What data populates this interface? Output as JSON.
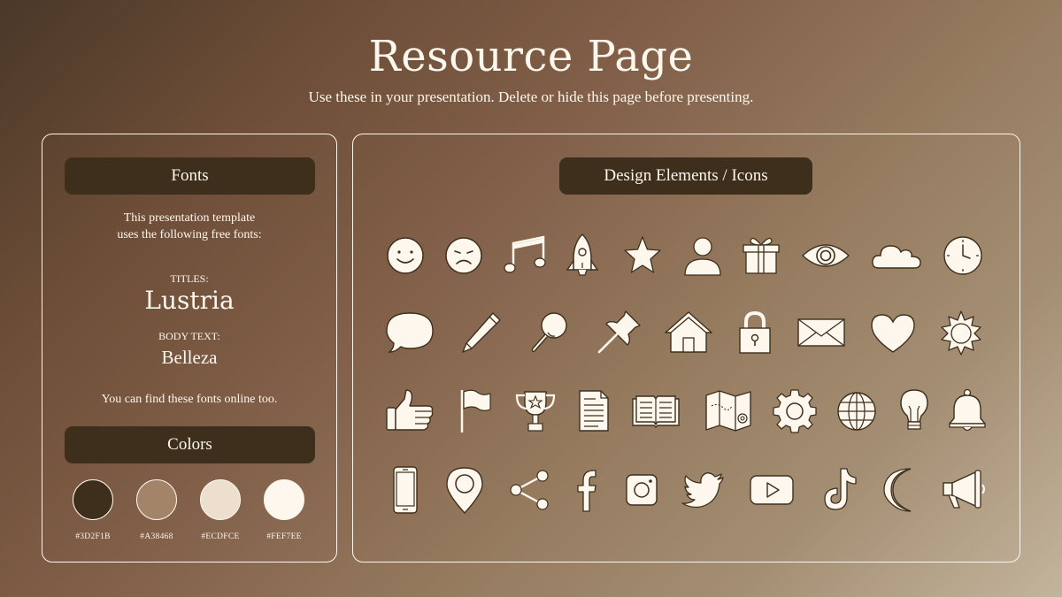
{
  "header": {
    "title": "Resource Page",
    "subtitle": "Use these in your presentation. Delete or hide this page before presenting."
  },
  "fonts_panel": {
    "heading": "Fonts",
    "intro_line1": "This presentation template",
    "intro_line2": "uses the following free fonts:",
    "titles_label": "TITLES:",
    "titles_font": "Lustria",
    "body_label": "BODY TEXT:",
    "body_font": "Belleza",
    "footer": "You can find these fonts online too."
  },
  "colors_panel": {
    "heading": "Colors",
    "swatches": [
      {
        "hex": "#3D2F1B",
        "color": "#3d2f1b"
      },
      {
        "hex": "#A38468",
        "color": "#a38468"
      },
      {
        "hex": "#ECDFCE",
        "color": "#ecdfce"
      },
      {
        "hex": "#FEF7EE",
        "color": "#fef7ee"
      }
    ]
  },
  "icons_panel": {
    "heading": "Design Elements / Icons",
    "icons": [
      "smile-icon",
      "sad-icon",
      "music-note-icon",
      "rocket-icon",
      "star-icon",
      "user-icon",
      "gift-icon",
      "eye-icon",
      "cloud-icon",
      "clock-icon",
      "speech-bubble-icon",
      "pencil-icon",
      "magnifier-icon",
      "pushpin-icon",
      "house-icon",
      "padlock-icon",
      "envelope-icon",
      "heart-icon",
      "sun-icon",
      "thumbs-up-icon",
      "flag-icon",
      "trophy-icon",
      "document-icon",
      "open-book-icon",
      "map-icon",
      "gear-icon",
      "globe-icon",
      "lightbulb-icon",
      "bell-icon",
      "smartphone-icon",
      "location-pin-icon",
      "share-icon",
      "facebook-icon",
      "instagram-icon",
      "twitter-icon",
      "youtube-icon",
      "tiktok-icon",
      "moon-icon",
      "megaphone-icon"
    ]
  },
  "colors": {
    "dark": "#3d2f1b",
    "light": "#fef7ee",
    "fill": "#fef7ee",
    "stroke": "#3d2f1b"
  }
}
